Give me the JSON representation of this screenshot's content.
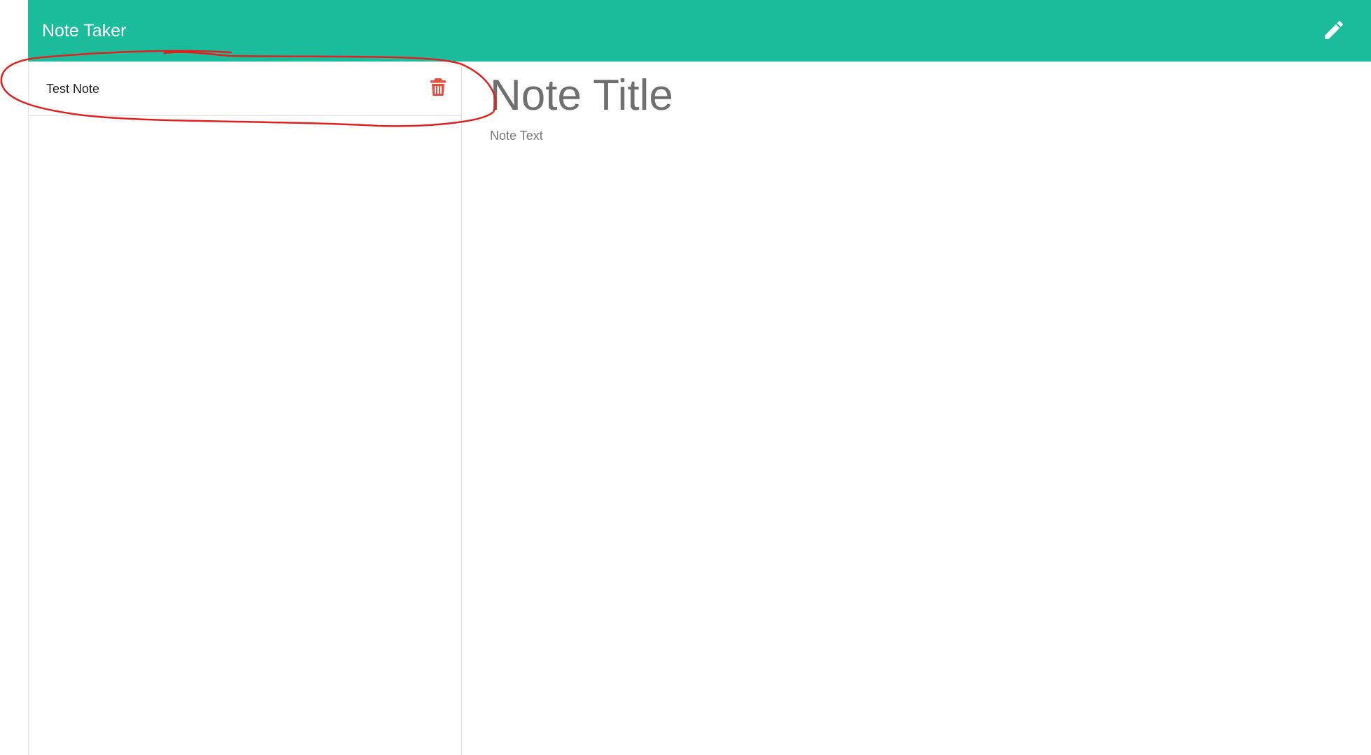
{
  "navbar": {
    "title": "Note Taker",
    "new_note_icon": "pencil-icon",
    "background_color": "#1abc9c"
  },
  "sidebar": {
    "notes": [
      {
        "title": "Test Note",
        "delete_icon": "trash-icon"
      }
    ]
  },
  "editor": {
    "title_placeholder": "Note Title",
    "text_placeholder": "Note Text"
  },
  "annotation": {
    "color": "#e02020",
    "shape": "hand-drawn circle around first note"
  }
}
